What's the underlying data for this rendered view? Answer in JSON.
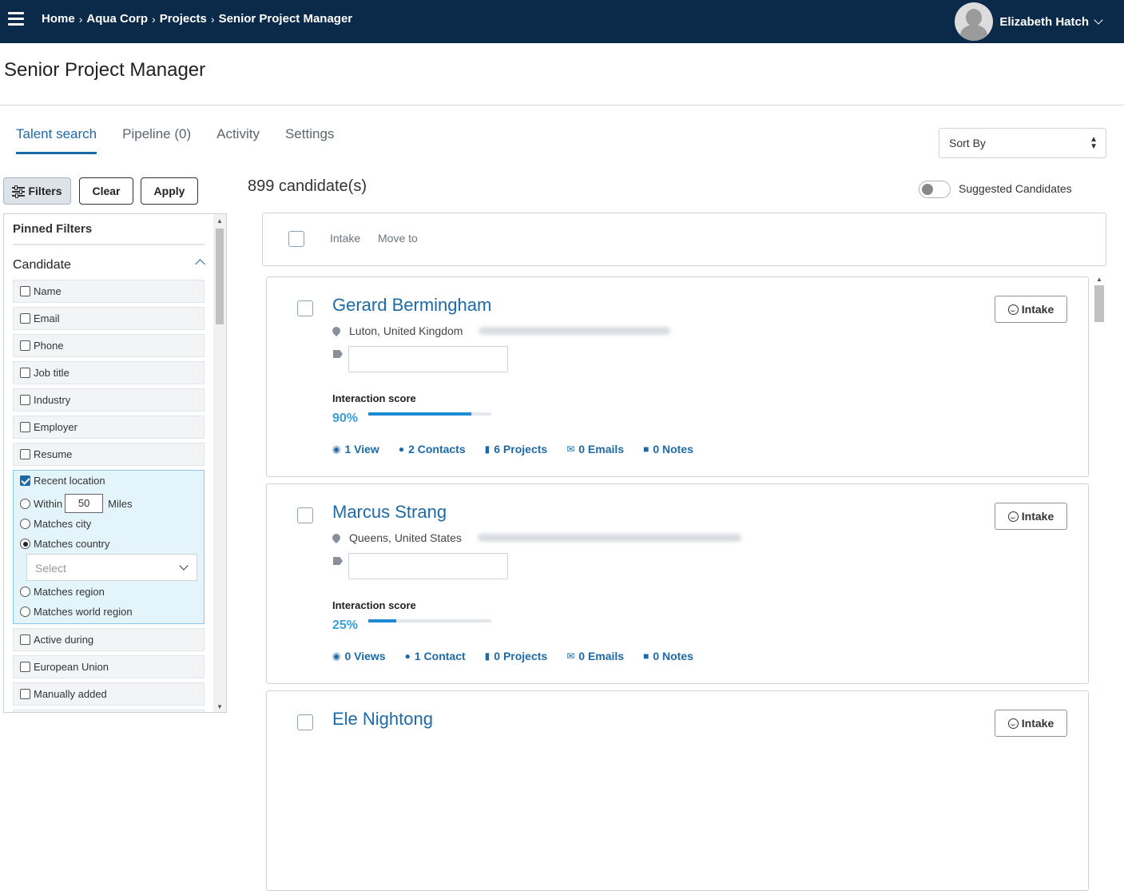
{
  "header": {
    "breadcrumb": [
      "Home",
      "Aqua Corp",
      "Projects",
      "Senior Project Manager"
    ],
    "user_name": "Elizabeth Hatch"
  },
  "page_title": "Senior Project Manager",
  "tabs": [
    {
      "label": "Talent search",
      "active": true
    },
    {
      "label": "Pipeline (0)",
      "active": false
    },
    {
      "label": "Activity",
      "active": false
    },
    {
      "label": "Settings",
      "active": false
    }
  ],
  "sort": {
    "label": "Sort By"
  },
  "filter_buttons": {
    "filters": "Filters",
    "clear": "Clear",
    "apply": "Apply"
  },
  "filters": {
    "pinned_label": "Pinned Filters",
    "candidate_label": "Candidate",
    "items_top": [
      "Name",
      "Email",
      "Phone",
      "Job title",
      "Industry",
      "Employer",
      "Resume"
    ],
    "recent_location": {
      "label": "Recent location",
      "checked": true,
      "within_label": "Within",
      "miles_value": "50",
      "miles_label": "Miles",
      "options": [
        "Matches city",
        "Matches country",
        "Matches region",
        "Matches world region"
      ],
      "selected_option": "Matches country",
      "select_placeholder": "Select"
    },
    "items_bottom": [
      "Active during",
      "European Union",
      "Manually added"
    ]
  },
  "results": {
    "count_text": "899 candidate(s)",
    "suggested_label": "Suggested Candidates",
    "bulk_actions": [
      "Intake",
      "Move to"
    ]
  },
  "candidates": [
    {
      "name": "Gerard Bermingham",
      "location": "Luton, United Kingdom",
      "score_label": "Interaction score",
      "score_text": "90%",
      "score": 0.84,
      "views": "1 View",
      "contacts": "2 Contacts",
      "projects": "6 Projects",
      "emails": "0 Emails",
      "notes": "0 Notes",
      "intake_label": "Intake"
    },
    {
      "name": "Marcus Strang",
      "location": "Queens, United States",
      "score_label": "Interaction score",
      "score_text": "25%",
      "score": 0.23,
      "views": "0 Views",
      "contacts": "1 Contact",
      "projects": "0 Projects",
      "emails": "0 Emails",
      "notes": "0 Notes",
      "intake_label": "Intake"
    },
    {
      "name": "Ele Nightong",
      "intake_label": "Intake"
    }
  ]
}
